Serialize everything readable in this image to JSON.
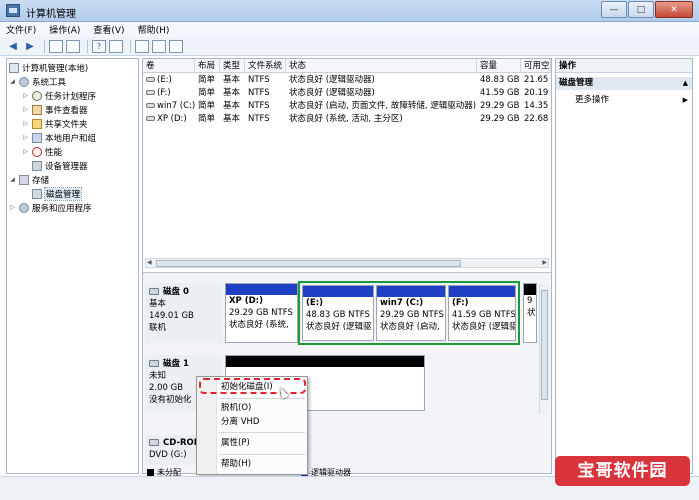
{
  "window": {
    "title": "计算机管理",
    "minimize": "—",
    "maximize": "□",
    "close": "✕"
  },
  "menu": [
    "文件(F)",
    "操作(A)",
    "查看(V)",
    "帮助(H)"
  ],
  "toolbar": {
    "back": "◀",
    "forward": "▶",
    "help": "?"
  },
  "tree": {
    "root": "计算机管理(本地)",
    "system_tools": "系统工具",
    "task_scheduler": "任务计划程序",
    "event_viewer": "事件查看器",
    "shared_folders": "共享文件夹",
    "local_users": "本地用户和组",
    "performance": "性能",
    "device_manager": "设备管理器",
    "storage": "存储",
    "disk_management": "磁盘管理",
    "services": "服务和应用程序"
  },
  "volume_table": {
    "columns": [
      "卷",
      "布局",
      "类型",
      "文件系统",
      "状态",
      "容量",
      "可用空"
    ],
    "rows": [
      {
        "volume": "(E:)",
        "layout": "简单",
        "type": "基本",
        "fs": "NTFS",
        "status": "状态良好 (逻辑驱动器)",
        "capacity": "48.83 GB",
        "free": "21.65"
      },
      {
        "volume": "(F:)",
        "layout": "简单",
        "type": "基本",
        "fs": "NTFS",
        "status": "状态良好 (逻辑驱动器)",
        "capacity": "41.59 GB",
        "free": "20.19"
      },
      {
        "volume": "win7 (C:)",
        "layout": "简单",
        "type": "基本",
        "fs": "NTFS",
        "status": "状态良好 (启动, 页面文件, 故障转储, 逻辑驱动器)",
        "capacity": "29.29 GB",
        "free": "14.35"
      },
      {
        "volume": "XP (D:)",
        "layout": "简单",
        "type": "基本",
        "fs": "NTFS",
        "status": "状态良好 (系统, 活动, 主分区)",
        "capacity": "29.29 GB",
        "free": "22.68"
      }
    ]
  },
  "disk0": {
    "name": "磁盘 0",
    "type": "基本",
    "size": "149.01 GB",
    "state": "联机",
    "partitions": [
      {
        "title": "XP  (D:)",
        "size": "29.29 GB NTFS",
        "status": "状态良好 (系统,"
      },
      {
        "title": "(E:)",
        "size": "48.83 GB NTFS",
        "status": "状态良好 (逻辑驱"
      },
      {
        "title": "win7  (C:)",
        "size": "29.29 GB NTFS",
        "status": "状态良好 (启动,"
      },
      {
        "title": "(F:)",
        "size": "41.59 GB NTFS",
        "status": "状态良好 (逻辑驱"
      },
      {
        "title": "",
        "size": "9",
        "status": "状"
      }
    ]
  },
  "disk1": {
    "name": "磁盘 1",
    "type": "未知",
    "size": "2.00 GB",
    "state": "没有初始化"
  },
  "cdrom": {
    "name": "CD-ROI",
    "drive": "DVD (G:)"
  },
  "legend": {
    "unallocated": "未分配",
    "logical": "逻辑驱动器",
    "unallocated_color": "#000000",
    "primary_color": "#1f3fc4"
  },
  "context_menu": {
    "initialize": "初始化磁盘(I)",
    "offline": "脱机(O)",
    "detach_vhd": "分离 VHD",
    "properties": "属性(P)",
    "help": "帮助(H)"
  },
  "actions": {
    "header": "操作",
    "section": "磁盘管理",
    "more": "更多操作",
    "arrow_up": "▲",
    "arrow_right": "▶"
  },
  "watermark": "宝哥软件园"
}
